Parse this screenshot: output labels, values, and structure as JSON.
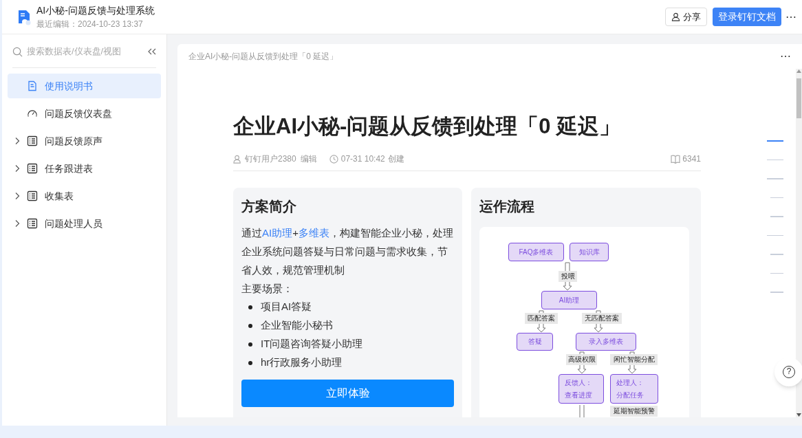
{
  "header": {
    "title": "AI小秘-问题反馈与处理系统",
    "subtitle": "最近编辑：2024-10-23 13:37",
    "share": "分享",
    "login": "登录钉钉文档",
    "more": "⋯"
  },
  "sidebar": {
    "search_placeholder": "搜索数据表/仪表盘/视图",
    "items": [
      {
        "label": "使用说明书",
        "kind": "doc",
        "selected": true,
        "expandable": false
      },
      {
        "label": "问题反馈仪表盘",
        "kind": "dashboard",
        "selected": false,
        "expandable": false
      },
      {
        "label": "问题反馈原声",
        "kind": "table",
        "selected": false,
        "expandable": true
      },
      {
        "label": "任务跟进表",
        "kind": "table",
        "selected": false,
        "expandable": true
      },
      {
        "label": "收集表",
        "kind": "table",
        "selected": false,
        "expandable": true
      },
      {
        "label": "问题处理人员",
        "kind": "table",
        "selected": false,
        "expandable": true
      }
    ]
  },
  "document": {
    "breadcrumb": "企业AI小秘-问题从反馈到处理「0 延迟」",
    "more": "⋯",
    "title": "企业AI小秘-问题从反馈到处理「0 延迟」",
    "author": "钉钉用户2380",
    "author_action": "编辑",
    "time": "07-31 10:42",
    "time_action": "创建",
    "views": "6341",
    "intro": {
      "heading": "方案简介",
      "paragraph": [
        {
          "text": "通过",
          "kind": "plain"
        },
        {
          "text": "AI助理",
          "kind": "link"
        },
        {
          "text": "+",
          "kind": "plain"
        },
        {
          "text": "多维表",
          "kind": "link"
        },
        {
          "text": "，构建智能企业小秘，处理企业系统问题答疑与日常问题与需求收集，节省人效，规范管理机制",
          "kind": "plain"
        }
      ],
      "scenes_label": "主要场景：",
      "scenes": [
        "项目AI答疑",
        "企业智能小秘书",
        "IT问题咨询答疑小助理",
        "hr行政服务小助理"
      ],
      "button": "立即体验"
    },
    "flow": {
      "heading": "运作流程",
      "nodes": [
        {
          "lines": [
            "FAQ多维表"
          ]
        },
        {
          "lines": [
            "知识库"
          ]
        },
        {
          "lines": [
            "AI助理"
          ]
        },
        {
          "lines": [
            "答疑"
          ]
        },
        {
          "lines": [
            "录入多维表"
          ]
        },
        {
          "lines": [
            "反馈人：",
            "查看进度"
          ]
        },
        {
          "lines": [
            "处理人：",
            "分配任务"
          ]
        }
      ],
      "edge_labels": [
        "投喂",
        "匹配答案",
        "无匹配答案",
        "高级权限",
        "闲忙智能分配",
        "延期智能预警"
      ]
    }
  },
  "toc": [
    {
      "selected": true
    },
    {
      "selected": false
    },
    {
      "selected": false,
      "children": [
        {
          "selected": false
        },
        {
          "selected": false
        }
      ]
    },
    {
      "selected": false,
      "children": [
        {
          "selected": false
        },
        {
          "selected": false
        },
        {
          "selected": false
        }
      ]
    }
  ],
  "help": "?"
}
